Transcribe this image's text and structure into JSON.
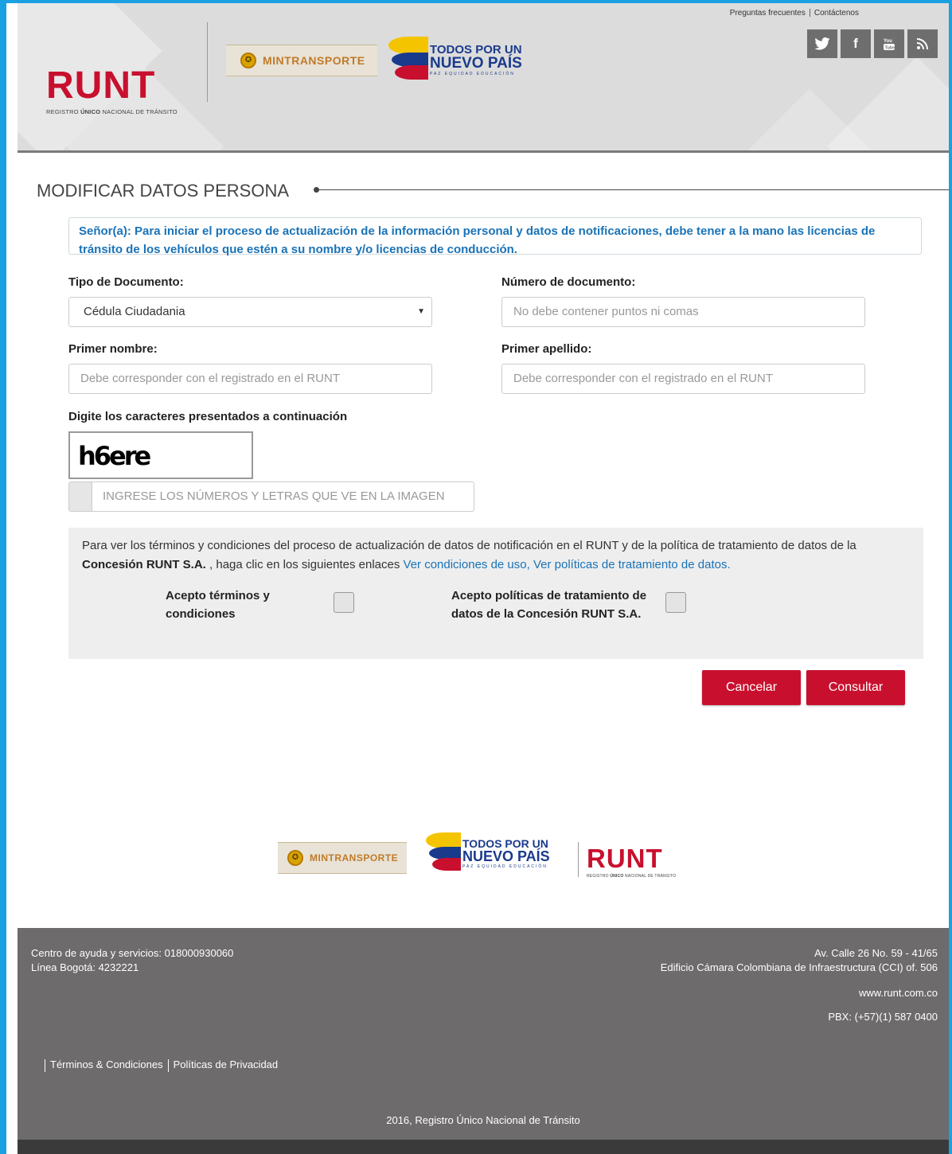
{
  "header": {
    "top_links": [
      "Preguntas frecuentes",
      "Contáctenos"
    ],
    "runt_logo": {
      "word": "RUNT",
      "subtitle_pre": "REGISTRO ",
      "subtitle_bold": "ÚNICO",
      "subtitle_post": " NACIONAL DE TRÁNSITO"
    },
    "mintransporte": "MINTRANSPORTE",
    "todos_line1": "TODOS POR UN",
    "todos_line2": "NUEVO PAÍS",
    "todos_line3": "PAZ  EQUIDAD  EDUCACIÓN",
    "social": [
      {
        "name": "twitter-icon",
        "glyph": "🐦"
      },
      {
        "name": "facebook-icon",
        "glyph": "f"
      },
      {
        "name": "youtube-icon",
        "glyph": "You"
      },
      {
        "name": "rss-icon",
        "glyph": "ℜ"
      }
    ]
  },
  "main": {
    "title": "MODIFICAR DATOS PERSONA",
    "notice": "Señor(a): Para iniciar el proceso de actualización de la información personal y datos de notificaciones, debe tener a la mano las licencias de tránsito de los vehículos que estén a su nombre y/o licencias de conducción.",
    "fields": {
      "tipo_documento": {
        "label": "Tipo de Documento:",
        "value": "Cédula Ciudadania"
      },
      "numero_documento": {
        "label": "Número de documento:",
        "placeholder": "No debe contener puntos ni comas"
      },
      "primer_nombre": {
        "label": "Primer nombre:",
        "placeholder": "Debe corresponder con el registrado en el RUNT"
      },
      "primer_apellido": {
        "label": "Primer apellido:",
        "placeholder": "Debe corresponder con el registrado en el RUNT"
      }
    },
    "captcha": {
      "label": "Digite los caracteres presentados a continuación",
      "text": "h6ere",
      "placeholder": "INGRESE LOS NÚMEROS Y LETRAS QUE VE EN LA IMAGEN"
    },
    "terms": {
      "text_pre": "Para ver los términos y condiciones del proceso de actualización de datos de notificación en el RUNT y de la política de tratamiento de datos de la ",
      "text_bold": "Concesión RUNT S.A.",
      "text_mid": " , haga clic en los siguientes enlaces ",
      "link1": "Ver condiciones de uso,",
      "link2": "Ver políticas de tratamiento de datos.",
      "accept_terms": "Acepto términos y condiciones",
      "accept_policy": "Acepto políticas de tratamiento de datos de la Concesión RUNT S.A."
    },
    "buttons": {
      "cancel": "Cancelar",
      "submit": "Consultar"
    }
  },
  "footer": {
    "help_line": "Centro de ayuda y servicios: 018000930060",
    "bogota_line": "Línea Bogotá: 4232221",
    "address1": "Av. Calle 26 No. 59 - 41/65",
    "address2": "Edificio Cámara Colombiana de Infraestructura (CCI) of. 506",
    "website": "www.runt.com.co",
    "pbx": "PBX: (+57)(1) 587 0400",
    "links": [
      "Términos & Condiciones",
      "Políticas de Privacidad"
    ],
    "copyright": "2016, Registro Único Nacional de Tránsito"
  },
  "colors": {
    "accent_red": "#c8102e",
    "link_blue": "#1a73b7",
    "frame_blue": "#1ba1e2",
    "footer_gray": "#6d6b6b"
  }
}
